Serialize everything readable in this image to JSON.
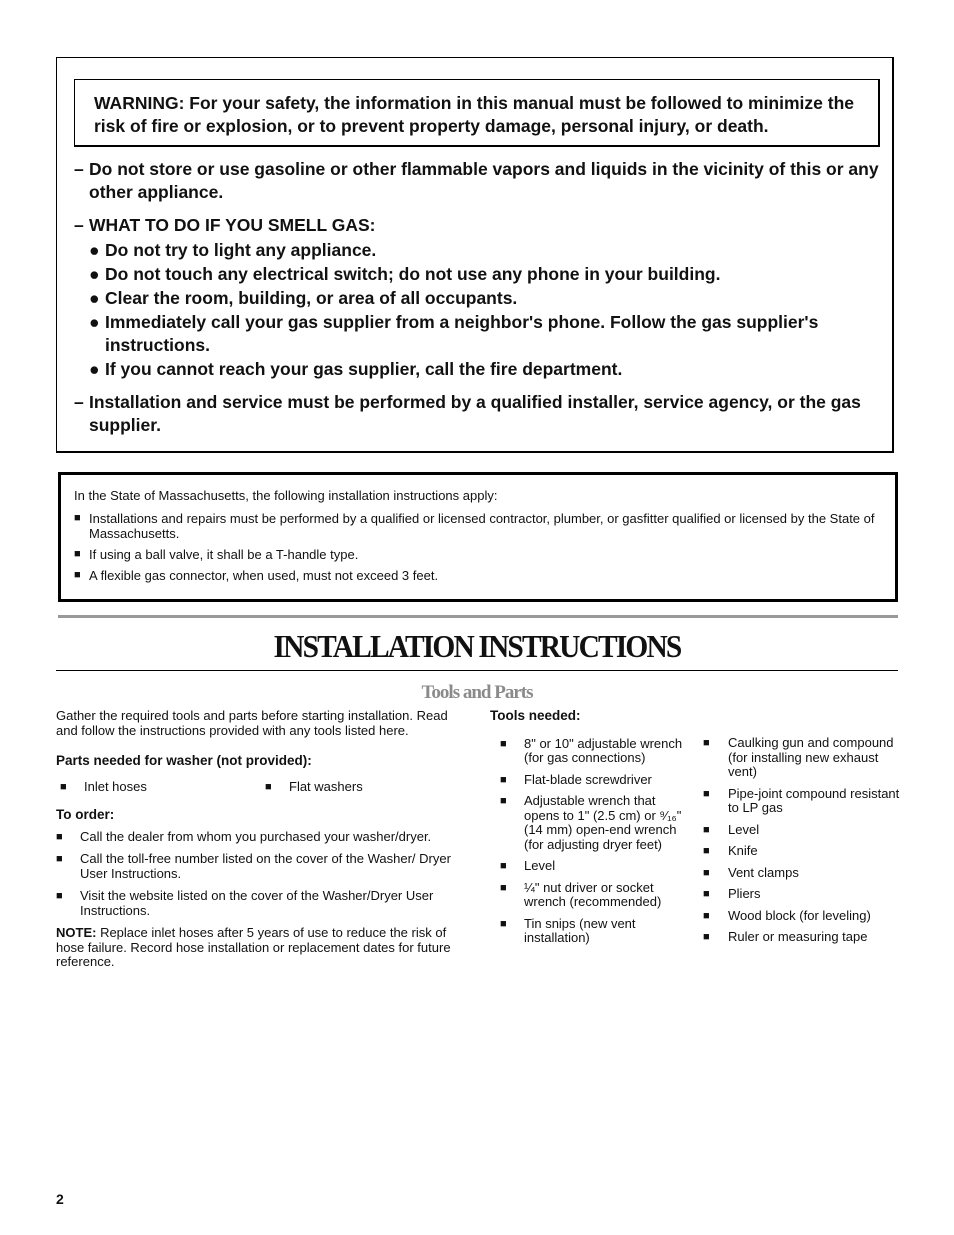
{
  "warning": {
    "box_text": "WARNING: For your safety, the information in this manual must be followed to minimize the risk of fire or explosion, or to prevent property damage, personal injury, or death.",
    "items": [
      {
        "dash": "–",
        "text": "Do not store or use gasoline or other flammable vapors and liquids in the vicinity of this or any other appliance."
      },
      {
        "dash": "–",
        "text": "WHAT TO DO IF YOU SMELL GAS:"
      },
      {
        "dash": "–",
        "text": "Installation and service must be performed by a qualified installer, service agency, or the gas supplier."
      }
    ],
    "gas_steps": [
      "Do not try to light any appliance.",
      "Do not touch any electrical switch; do not use any phone in your building.",
      "Clear the room, building, or area of all occupants.",
      "Immediately call your gas supplier from a neighbor's phone. Follow the gas supplier's instructions.",
      "If you cannot reach your gas supplier, call the fire department."
    ],
    "bullet_glyph": "●"
  },
  "massachusetts": {
    "intro": "In the State of Massachusetts, the following installation instructions apply:",
    "items": [
      "Installations and repairs must be performed by a qualified or licensed contractor, plumber, or gasfitter qualified or licensed by the State of Massachusetts.",
      "If using a ball valve, it shall be a T-handle type.",
      "A flexible gas connector, when used, must not exceed 3 feet."
    ]
  },
  "square_glyph": "■",
  "title": "INSTALLATION INSTRUCTIONS",
  "section_title": "Tools and Parts",
  "left": {
    "intro": "Gather the required tools and parts before starting installation. Read and follow the instructions provided with any tools listed here.",
    "parts_heading": "Parts needed for washer (not provided):",
    "parts": [
      "Inlet hoses",
      "Flat washers"
    ],
    "order_heading": "To order:",
    "order_items": [
      "Call the dealer from whom you purchased your washer/dryer.",
      "Call the toll-free number listed on the cover of the Washer/ Dryer User Instructions.",
      "Visit the website listed on the cover of the Washer/Dryer User Instructions."
    ],
    "note_label": "NOTE:",
    "note_text": " Replace inlet hoses after 5 years of use to reduce the risk of hose failure. Record hose installation or replacement dates for future reference."
  },
  "tools": {
    "heading": "Tools needed:",
    "col1": [
      "8\" or 10\" adjustable wrench (for gas connections)",
      "Flat-blade screwdriver",
      "Adjustable wrench that opens to 1\" (2.5 cm) or ⁹⁄₁₆\" (14 mm) open-end wrench (for adjusting dryer feet)",
      "Level",
      "¼\" nut driver or socket wrench (recommended)",
      "Tin snips (new vent installation)"
    ],
    "col2": [
      "Caulking gun and compound (for installing new exhaust vent)",
      "Pipe-joint compound resistant to LP gas",
      "Level",
      "Knife",
      "Vent clamps",
      "Pliers",
      "Wood block (for leveling)",
      "Ruler or measuring tape"
    ]
  },
  "page_number": "2"
}
